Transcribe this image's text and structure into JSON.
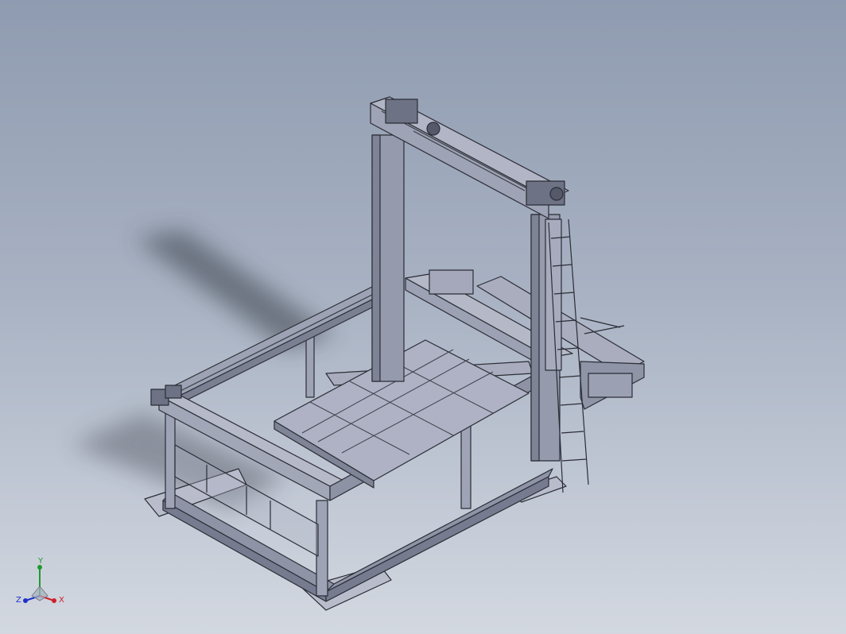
{
  "viewport": {
    "background_top": "#8f9bb0",
    "background_bottom": "#d3d8e0"
  },
  "model": {
    "frame_color": "#8e93a6",
    "edge_color": "#2b2d36",
    "plate_color": "#a5a9bd",
    "shadow_color": "#3a3f4a"
  },
  "triad": {
    "x_label": "X",
    "y_label": "Y",
    "z_label": "Z",
    "x_color": "#d0202a",
    "y_color": "#1e9a2e",
    "z_color": "#2030c8"
  }
}
